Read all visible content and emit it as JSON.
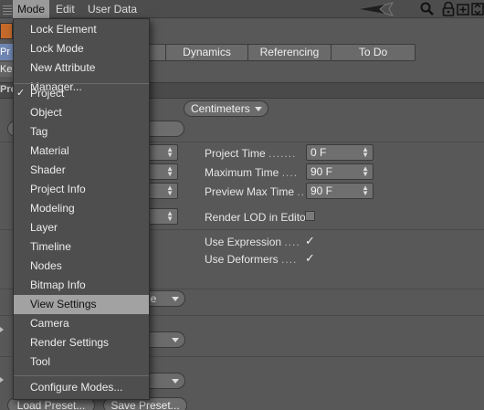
{
  "menubar": {
    "items": [
      "Mode",
      "Edit",
      "User Data"
    ],
    "active": "Mode"
  },
  "tabs": [
    "Dynamics",
    "Referencing",
    "To Do"
  ],
  "left_strip": {
    "tab_label": "Pr",
    "key_label": "Ke",
    "section_label": "Pro"
  },
  "unit_select": {
    "value": "Centimeters"
  },
  "right_fields": [
    {
      "label": "Project Time",
      "value": "0 F"
    },
    {
      "label": "Maximum Time",
      "value": "90 F"
    },
    {
      "label": "Preview Max Time",
      "value": "90 F"
    }
  ],
  "render_lod": {
    "label": "Render LOD in Editor",
    "checked": false
  },
  "use_expression": {
    "label": "Use Expression",
    "checked": true
  },
  "use_deformers": {
    "label": "Use Deformers",
    "checked": true
  },
  "partial_dropdown": {
    "value": "ue"
  },
  "buttons": {
    "load_preset": "Load Preset...",
    "save_preset": "Save Preset..."
  },
  "menu": {
    "group1": [
      "Lock Element",
      "Lock Mode",
      "New Attribute Manager..."
    ],
    "group2": [
      "Project",
      "Object",
      "Tag",
      "Material",
      "Shader",
      "Project Info",
      "Modeling",
      "Layer",
      "Timeline",
      "Nodes",
      "Bitmap Info",
      "View Settings",
      "Camera",
      "Render Settings",
      "Tool"
    ],
    "group3": [
      "Configure Modes..."
    ],
    "checked_item": "Project",
    "highlighted_item": "View Settings"
  },
  "colors": {
    "background": "#585858",
    "menu_bg": "#4e4e4e",
    "highlight": "#a2a2a2"
  }
}
